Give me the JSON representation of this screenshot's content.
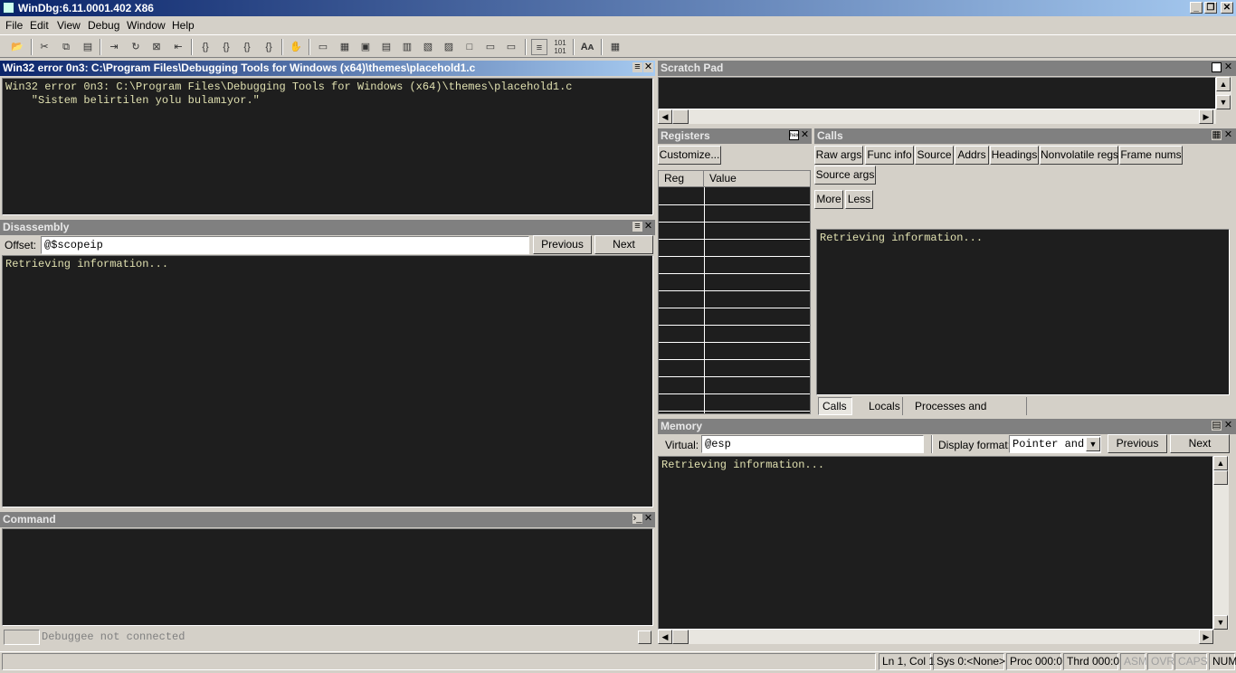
{
  "app": {
    "title": "WinDbg:6.11.0001.402 X86",
    "window_buttons": {
      "minimize": "_",
      "restore": "❐",
      "close": "✕"
    }
  },
  "menu": [
    "File",
    "Edit",
    "View",
    "Debug",
    "Window",
    "Help"
  ],
  "source_pane": {
    "title": "Win32 error 0n3: C:\\Program Files\\Debugging Tools for Windows (x64)\\themes\\placehold1.c",
    "content": "Win32 error 0n3: C:\\Program Files\\Debugging Tools for Windows (x64)\\themes\\placehold1.c\n    \"Sistem belirtilen yolu bulamıyor.\""
  },
  "disassembly": {
    "title": "Disassembly",
    "offset_label": "Offset:",
    "offset_value": "@$scopeip",
    "previous": "Previous",
    "next": "Next",
    "content": "Retrieving information..."
  },
  "command": {
    "title": "Command",
    "status_text": "Debuggee not connected"
  },
  "scratch_pad": {
    "title": "Scratch Pad"
  },
  "registers": {
    "title": "Registers",
    "customize": "Customize...",
    "columns": [
      "Reg",
      "Value"
    ]
  },
  "calls": {
    "title": "Calls",
    "buttons": [
      "Raw args",
      "Func info",
      "Source",
      "Addrs",
      "Headings",
      "Nonvolatile regs",
      "Frame nums",
      "Source args",
      "More",
      "Less"
    ],
    "content": "Retrieving information...",
    "tabs": [
      "Calls",
      "Locals",
      "Processes and Threads"
    ]
  },
  "memory": {
    "title": "Memory",
    "virtual_label": "Virtual:",
    "virtual_value": "@esp",
    "display_format_label": "Display format:",
    "display_format_value": "Pointer and",
    "previous": "Previous",
    "next": "Next",
    "content": "Retrieving information..."
  },
  "statusbar": {
    "position": "Ln 1, Col 1",
    "sys": "Sys 0:<None>",
    "proc": "Proc 000:0",
    "thrd": "Thrd 000:0",
    "asm": "ASM",
    "ovr": "OVR",
    "caps": "CAPS",
    "num": "NUM"
  }
}
